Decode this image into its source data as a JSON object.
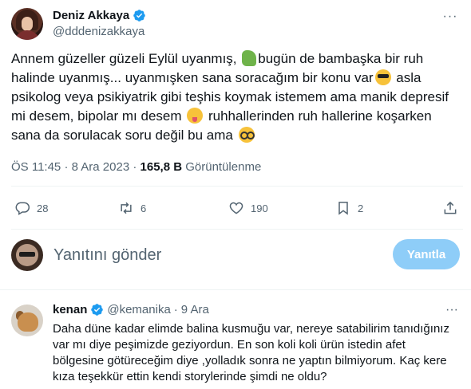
{
  "author": {
    "display_name": "Deniz Akkaya",
    "handle": "@dddenizakkaya"
  },
  "tweet": {
    "line1a": "Annem güzeller güzeli Eylül  uyanmış, ",
    "line1b": "bugün de bambaşka bir ruh",
    "line2a": "halinde uyanmış... uyanmışken sana soracağım bir konu var",
    "line2b": " asla",
    "line3": "psikolog veya psikiyatrik gibi teşhis koymak istemem ama manik depresif",
    "line4a": "mi desem, bipolar mı desem ",
    "line4b": " ruhhallerinden ruh hallerine koşarken",
    "line5a": "sana da sorulacak soru değil bu ama ",
    "emojis": [
      "dinosaur-emoji",
      "sunglasses-emoji",
      "winking-tongue-emoji",
      "nerd-emoji"
    ]
  },
  "meta": {
    "time": "ÖS 11:45",
    "separator": "·",
    "date": "8 Ara 2023",
    "views_count": "165,8 B",
    "views_label": "Görüntülenme"
  },
  "actions": {
    "replies": "28",
    "retweets": "6",
    "likes": "190",
    "bookmarks": "2"
  },
  "compose": {
    "placeholder": "Yanıtını gönder",
    "button_label": "Yanıtla"
  },
  "reply": {
    "display_name": "kenan",
    "handle": "@kemanika",
    "separator": "·",
    "date": "9 Ara",
    "text": "Daha düne kadar elimde balina kusmuğu var, nereye satabilirim tanıdığınız var mı diye peşimizde geziyordun. En son koli koli ürün istedin afet bölgesine götüreceğim diye ,yolladık sonra ne yaptın bilmiyorum. Kaç kere kıza teşekkür ettin kendi storylerinde şimdi ne oldu?"
  },
  "colors": {
    "accent": "#1d9bf0",
    "accent_disabled": "#8ecdf8",
    "secondary_text": "#536471",
    "divider": "#eff3f4"
  }
}
